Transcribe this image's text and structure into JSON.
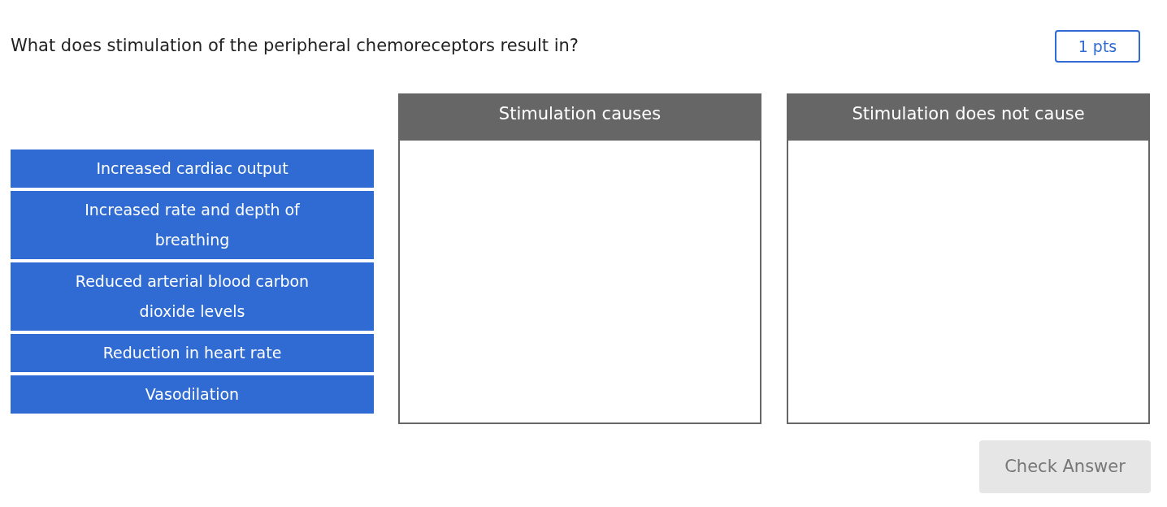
{
  "question": "What does stimulation of the peripheral chemoreceptors result in?",
  "points": "1 pts",
  "items": [
    {
      "label": "Increased cardiac output"
    },
    {
      "label": "Increased rate and depth of breathing"
    },
    {
      "label": "Reduced arterial blood carbon dioxide levels"
    },
    {
      "label": "Reduction in heart rate"
    },
    {
      "label": "Vasodilation"
    }
  ],
  "buckets": [
    {
      "title": "Stimulation causes"
    },
    {
      "title": "Stimulation does not cause"
    }
  ],
  "check_button": {
    "label": "Check Answer",
    "disabled": true
  }
}
